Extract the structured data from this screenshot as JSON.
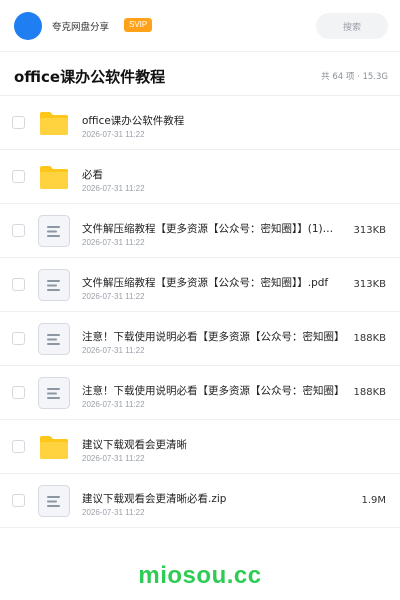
{
  "header": {
    "owner_name": "夸克网盘分享",
    "badge": "SVIP",
    "search_placeholder": "搜索"
  },
  "folder": {
    "title": "office课办公软件教程",
    "meta": "共 64 项 · 15.3G"
  },
  "files": [
    {
      "icon": "folder-icon",
      "name": "office课办公软件教程",
      "date": "2026-07-31 11:22",
      "size": ""
    },
    {
      "icon": "folder-icon",
      "name": "必看",
      "date": "2026-07-31 11:22",
      "size": ""
    },
    {
      "icon": "document-icon",
      "name": "文件解压缩教程【更多资源【公众号：密知圈】】(1)…",
      "date": "2026-07-31 11:22",
      "size": "313KB"
    },
    {
      "icon": "document-icon",
      "name": "文件解压缩教程【更多资源【公众号：密知圈】】.pdf",
      "date": "2026-07-31 11:22",
      "size": "313KB"
    },
    {
      "icon": "document-icon",
      "name": "注意！下载使用说明必看【更多资源【公众号：密知圈】",
      "date": "2026-07-31 11:22",
      "size": "188KB"
    },
    {
      "icon": "document-icon",
      "name": "注意！下载使用说明必看【更多资源【公众号：密知圈】",
      "date": "2026-07-31 11:22",
      "size": "188KB"
    },
    {
      "icon": "folder-icon",
      "name": "建议下载观看会更清晰",
      "date": "2026-07-31 11:22",
      "size": ""
    },
    {
      "icon": "document-icon",
      "name": "建议下载观看会更清晰必看.zip",
      "date": "2026-07-31 11:22",
      "size": "1.9M"
    }
  ],
  "watermark": "miosou.cc",
  "colors": {
    "accent": "#1f7ff2",
    "badge": "#ffa21a",
    "folder": "#ffc61a",
    "watermark": "#2ecc55"
  }
}
